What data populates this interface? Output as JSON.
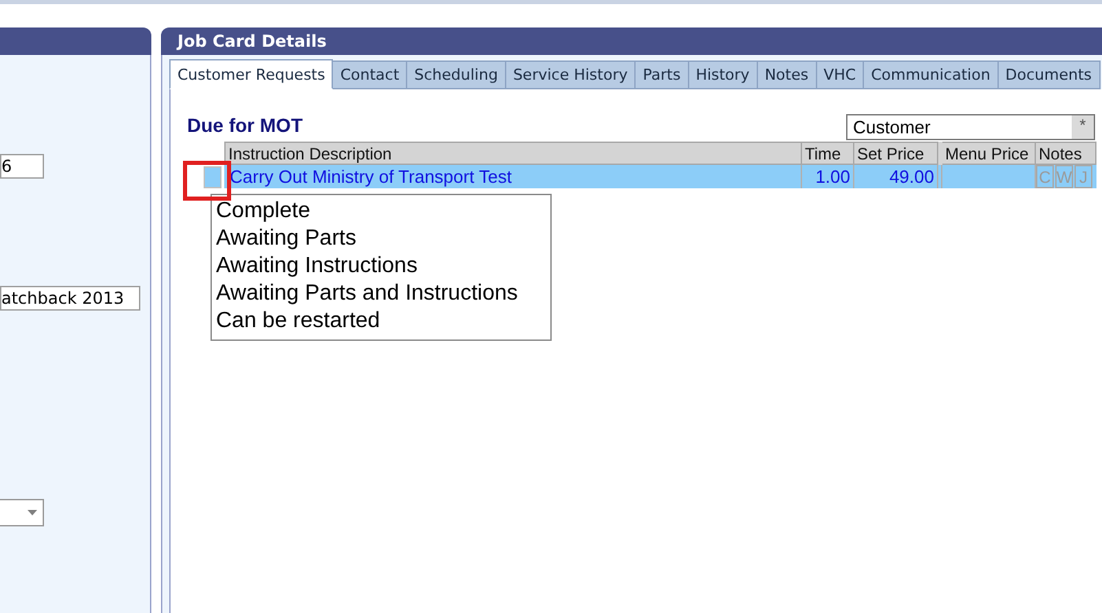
{
  "left_panel": {
    "fields": [
      {
        "kind": "text",
        "value": "6"
      },
      {
        "kind": "text",
        "value": "atchback 2013"
      },
      {
        "kind": "dropdown"
      }
    ]
  },
  "job_card": {
    "title": "Job Card Details",
    "tabs": [
      {
        "label": "Customer Requests",
        "selected": true
      },
      {
        "label": "Contact",
        "selected": false
      },
      {
        "label": "Scheduling",
        "selected": false
      },
      {
        "label": "Service History",
        "selected": false
      },
      {
        "label": "Parts",
        "selected": false
      },
      {
        "label": "History",
        "selected": false
      },
      {
        "label": "Notes",
        "selected": false
      },
      {
        "label": "VHC",
        "selected": false
      },
      {
        "label": "Communication",
        "selected": false
      },
      {
        "label": "Documents",
        "selected": false
      }
    ],
    "heading": "Due for MOT",
    "filter": {
      "value": "Customer",
      "button_glyph": "*"
    },
    "grid": {
      "columns": [
        "Instruction Description",
        "Time",
        "Set Price",
        "Menu Price",
        "Notes"
      ],
      "rows": [
        {
          "description": "Carry Out Ministry of Transport Test",
          "time": "1.00",
          "set_price": "49.00",
          "notes": [
            "C",
            "W",
            "J"
          ],
          "selected": true
        }
      ]
    }
  },
  "status_menu": {
    "items": [
      "Complete",
      "Awaiting Parts",
      "Awaiting Instructions",
      "Awaiting Parts and Instructions",
      "Can be restarted"
    ]
  }
}
